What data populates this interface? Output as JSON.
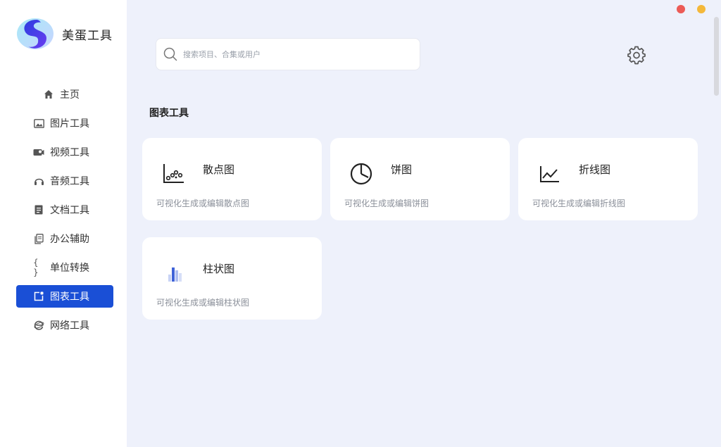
{
  "app": {
    "name": "美蛋工具"
  },
  "sidebar": {
    "items": [
      {
        "label": "主页",
        "icon": "home-icon"
      },
      {
        "label": "图片工具",
        "icon": "image-icon"
      },
      {
        "label": "视频工具",
        "icon": "video-icon"
      },
      {
        "label": "音频工具",
        "icon": "headphones-icon"
      },
      {
        "label": "文档工具",
        "icon": "document-icon"
      },
      {
        "label": "办公辅助",
        "icon": "copy-icon"
      },
      {
        "label": "单位转换",
        "icon": "braces-icon"
      },
      {
        "label": "图表工具",
        "icon": "chart-tool-icon",
        "active": true
      },
      {
        "label": "网络工具",
        "icon": "browser-icon"
      }
    ]
  },
  "search": {
    "placeholder": "搜索项目、合集或用户",
    "value": ""
  },
  "section": {
    "title": "图表工具"
  },
  "cards": [
    {
      "title": "散点图",
      "desc": "可视化生成或编辑散点图",
      "icon": "scatter-chart-icon"
    },
    {
      "title": "饼图",
      "desc": "可视化生成或编辑饼图",
      "icon": "pie-chart-icon"
    },
    {
      "title": "折线图",
      "desc": "可视化生成或编辑折线图",
      "icon": "line-chart-icon"
    },
    {
      "title": "柱状图",
      "desc": "可视化生成或编辑柱状图",
      "icon": "bar-chart-icon"
    }
  ],
  "colors": {
    "accent": "#1a4fd6",
    "background": "#eef1fb",
    "window_close": "#ec5b56",
    "window_minimize": "#f4b83a"
  }
}
